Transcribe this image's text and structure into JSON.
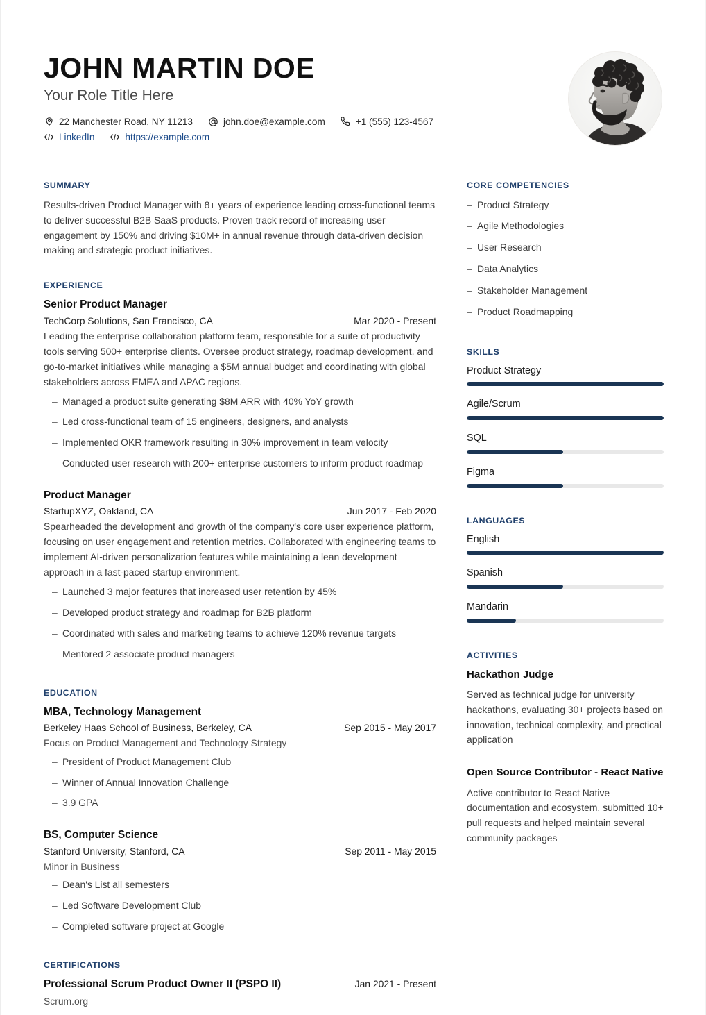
{
  "header": {
    "name": "JOHN MARTIN DOE",
    "role": "Your Role Title Here",
    "contacts": {
      "address": "22 Manchester Road, NY 11213",
      "email": "john.doe@example.com",
      "phone": "+1 (555) 123-4567",
      "linkedin": "LinkedIn",
      "website": "https://example.com"
    },
    "icons": {
      "location": "location-pin-icon",
      "email": "at-sign-icon",
      "phone": "phone-icon",
      "link": "link-code-icon"
    },
    "photo_alt": "profile-photo"
  },
  "colors": {
    "accent": "#1f3f6b",
    "meter_fill": "#1a3554",
    "meter_track": "#e8e8e8",
    "link": "#1b4a8a"
  },
  "main": {
    "summary": {
      "title": "SUMMARY",
      "text": "Results-driven Product Manager with 8+ years of experience leading cross-functional teams to deliver successful B2B SaaS products. Proven track record of increasing user engagement by 150% and driving $10M+ in annual revenue through data-driven decision making and strategic product initiatives."
    },
    "experience": {
      "title": "EXPERIENCE",
      "entries": [
        {
          "role": "Senior Product Manager",
          "org": "TechCorp Solutions, San Francisco, CA",
          "date": "Mar 2020 - Present",
          "desc": "Leading the enterprise collaboration platform team, responsible for a suite of productivity tools serving 500+ enterprise clients. Oversee product strategy, roadmap development, and go-to-market initiatives while managing a $5M annual budget and coordinating with global stakeholders across EMEA and APAC regions.",
          "bullets": [
            "Managed a product suite generating $8M ARR with 40% YoY growth",
            "Led cross-functional team of 15 engineers, designers, and analysts",
            "Implemented OKR framework resulting in 30% improvement in team velocity",
            "Conducted user research with 200+ enterprise customers to inform product roadmap"
          ]
        },
        {
          "role": "Product Manager",
          "org": "StartupXYZ, Oakland, CA",
          "date": "Jun 2017 - Feb 2020",
          "desc": "Spearheaded the development and growth of the company's core user experience platform, focusing on user engagement and retention metrics. Collaborated with engineering teams to implement AI-driven personalization features while maintaining a lean development approach in a fast-paced startup environment.",
          "bullets": [
            "Launched 3 major features that increased user retention by 45%",
            "Developed product strategy and roadmap for B2B platform",
            "Coordinated with sales and marketing teams to achieve 120% revenue targets",
            "Mentored 2 associate product managers"
          ]
        }
      ]
    },
    "education": {
      "title": "EDUCATION",
      "entries": [
        {
          "degree": "MBA, Technology Management",
          "school": "Berkeley Haas School of Business, Berkeley, CA",
          "date": "Sep 2015 - May 2017",
          "focus": "Focus on Product Management and Technology Strategy",
          "bullets": [
            "President of Product Management Club",
            "Winner of Annual Innovation Challenge",
            "3.9 GPA"
          ]
        },
        {
          "degree": "BS, Computer Science",
          "school": "Stanford University, Stanford, CA",
          "date": "Sep 2011 - May 2015",
          "focus": "Minor in Business",
          "bullets": [
            "Dean's List all semesters",
            "Led Software Development Club",
            "Completed software project at Google"
          ]
        }
      ]
    },
    "certifications": {
      "title": "CERTIFICATIONS",
      "entries": [
        {
          "name": "Professional Scrum Product Owner II (PSPO II)",
          "date": "Jan 2021 - Present",
          "issuer": "Scrum.org"
        }
      ]
    }
  },
  "side": {
    "competencies": {
      "title": "CORE COMPETENCIES",
      "items": [
        "Product Strategy",
        "Agile Methodologies",
        "User Research",
        "Data Analytics",
        "Stakeholder Management",
        "Product Roadmapping"
      ]
    },
    "skills": {
      "title": "SKILLS",
      "items": [
        {
          "label": "Product Strategy",
          "level": 100
        },
        {
          "label": "Agile/Scrum",
          "level": 100
        },
        {
          "label": "SQL",
          "level": 49
        },
        {
          "label": "Figma",
          "level": 49
        }
      ]
    },
    "languages": {
      "title": "LANGUAGES",
      "items": [
        {
          "label": "English",
          "level": 100
        },
        {
          "label": "Spanish",
          "level": 49
        },
        {
          "label": "Mandarin",
          "level": 25
        }
      ]
    },
    "activities": {
      "title": "ACTIVITIES",
      "items": [
        {
          "name": "Hackathon Judge",
          "desc": "Served as technical judge for university hackathons, evaluating 30+ projects based on innovation, technical complexity, and practical application"
        },
        {
          "name": "Open Source Contributor - React Native",
          "desc": "Active contributor to React Native documentation and ecosystem, submitted 10+ pull requests and helped maintain several community packages"
        }
      ]
    }
  }
}
